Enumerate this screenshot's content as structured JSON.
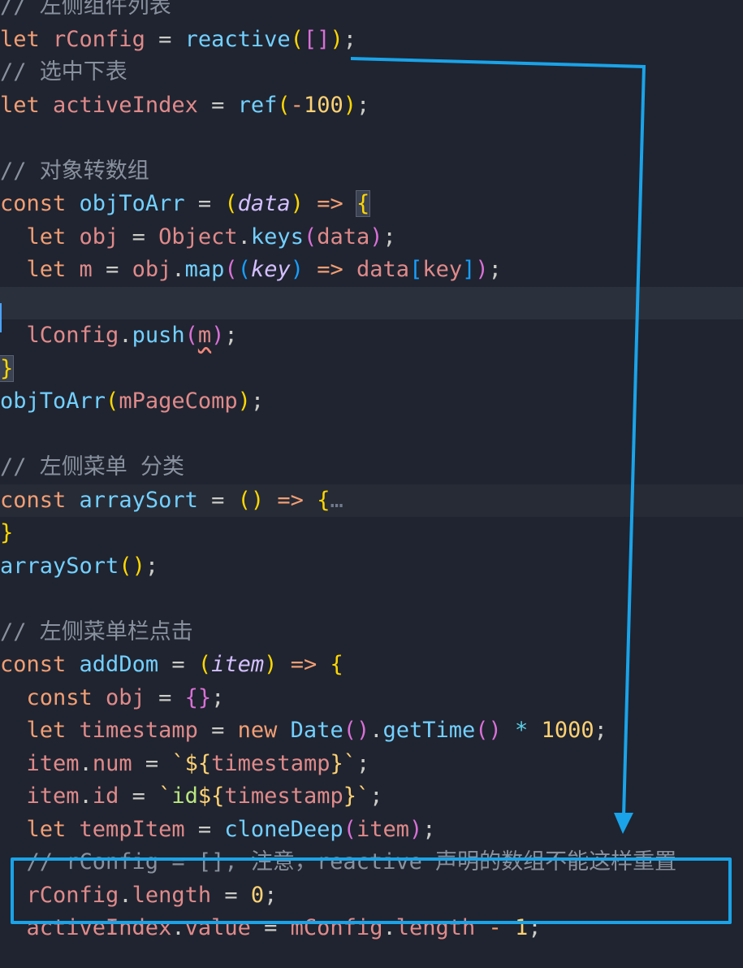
{
  "editor": {
    "lines": [
      {
        "id": "l0",
        "tokens": [
          {
            "t": "// 左侧组件列表",
            "c": "comment"
          }
        ]
      },
      {
        "id": "l1",
        "tokens": [
          {
            "t": "let ",
            "c": "kw"
          },
          {
            "t": "rConfig",
            "c": "var"
          },
          {
            "t": " = ",
            "c": "plain"
          },
          {
            "t": "reactive",
            "c": "fnb"
          },
          {
            "t": "(",
            "c": "p1"
          },
          {
            "t": "[]",
            "c": "p2"
          },
          {
            "t": ")",
            "c": "p1"
          },
          {
            "t": ";",
            "c": "plain"
          }
        ]
      },
      {
        "id": "l2",
        "tokens": [
          {
            "t": "// 选中下表",
            "c": "comment"
          }
        ]
      },
      {
        "id": "l3",
        "tokens": [
          {
            "t": "let ",
            "c": "kw"
          },
          {
            "t": "activeIndex",
            "c": "var"
          },
          {
            "t": " = ",
            "c": "plain"
          },
          {
            "t": "ref",
            "c": "fnb"
          },
          {
            "t": "(",
            "c": "p1"
          },
          {
            "t": "-",
            "c": "op"
          },
          {
            "t": "100",
            "c": "fn"
          },
          {
            "t": ")",
            "c": "p1"
          },
          {
            "t": ";",
            "c": "plain"
          }
        ]
      },
      {
        "id": "l4",
        "tokens": []
      },
      {
        "id": "l5",
        "tokens": [
          {
            "t": "// 对象转数组",
            "c": "comment"
          }
        ]
      },
      {
        "id": "l6",
        "tokens": [
          {
            "t": "const ",
            "c": "kw"
          },
          {
            "t": "objToArr",
            "c": "fnb"
          },
          {
            "t": " = ",
            "c": "plain"
          },
          {
            "t": "(",
            "c": "p1"
          },
          {
            "t": "data",
            "c": "param"
          },
          {
            "t": ")",
            "c": "p1"
          },
          {
            "t": " => ",
            "c": "op"
          },
          {
            "t": "{",
            "c": "p1",
            "brace": true
          }
        ]
      },
      {
        "id": "l7",
        "tokens": [
          {
            "t": "  let ",
            "c": "kw"
          },
          {
            "t": "obj",
            "c": "var"
          },
          {
            "t": " = ",
            "c": "plain"
          },
          {
            "t": "Object",
            "c": "var"
          },
          {
            "t": ".",
            "c": "plain"
          },
          {
            "t": "keys",
            "c": "fnb"
          },
          {
            "t": "(",
            "c": "p2"
          },
          {
            "t": "data",
            "c": "var"
          },
          {
            "t": ")",
            "c": "p2"
          },
          {
            "t": ";",
            "c": "plain"
          }
        ]
      },
      {
        "id": "l8",
        "tokens": [
          {
            "t": "  let ",
            "c": "kw"
          },
          {
            "t": "m",
            "c": "var"
          },
          {
            "t": " = ",
            "c": "plain"
          },
          {
            "t": "obj",
            "c": "var"
          },
          {
            "t": ".",
            "c": "plain"
          },
          {
            "t": "map",
            "c": "fnb"
          },
          {
            "t": "(",
            "c": "p2"
          },
          {
            "t": "(",
            "c": "p3"
          },
          {
            "t": "key",
            "c": "param"
          },
          {
            "t": ")",
            "c": "p3"
          },
          {
            "t": " => ",
            "c": "op"
          },
          {
            "t": "data",
            "c": "var"
          },
          {
            "t": "[",
            "c": "p3"
          },
          {
            "t": "key",
            "c": "var"
          },
          {
            "t": "]",
            "c": "p3"
          },
          {
            "t": ")",
            "c": "p2"
          },
          {
            "t": ";",
            "c": "plain"
          }
        ]
      },
      {
        "id": "l9",
        "tokens": [],
        "current": true
      },
      {
        "id": "l10",
        "tokens": [
          {
            "t": "  lConfig",
            "c": "var"
          },
          {
            "t": ".",
            "c": "plain"
          },
          {
            "t": "push",
            "c": "fnb"
          },
          {
            "t": "(",
            "c": "p2"
          },
          {
            "t": "m",
            "c": "var",
            "squiggle": true
          },
          {
            "t": ")",
            "c": "p2"
          },
          {
            "t": ";",
            "c": "plain"
          }
        ]
      },
      {
        "id": "l11",
        "tokens": [
          {
            "t": "}",
            "c": "p1",
            "brace": true
          }
        ]
      },
      {
        "id": "l12",
        "tokens": [
          {
            "t": "objToArr",
            "c": "fnb"
          },
          {
            "t": "(",
            "c": "p1"
          },
          {
            "t": "mPageComp",
            "c": "var"
          },
          {
            "t": ")",
            "c": "p1"
          },
          {
            "t": ";",
            "c": "plain"
          }
        ]
      },
      {
        "id": "l13",
        "tokens": []
      },
      {
        "id": "l14",
        "tokens": [
          {
            "t": "// 左侧菜单 分类",
            "c": "comment"
          }
        ]
      },
      {
        "id": "l15",
        "tokens": [
          {
            "t": "const ",
            "c": "kw"
          },
          {
            "t": "arraySort",
            "c": "fnb"
          },
          {
            "t": " = ",
            "c": "plain"
          },
          {
            "t": "()",
            "c": "p1"
          },
          {
            "t": " => ",
            "c": "op"
          },
          {
            "t": "{",
            "c": "p1"
          },
          {
            "t": "…",
            "c": "fold-dots"
          }
        ],
        "highlight": true
      },
      {
        "id": "l16",
        "tokens": [
          {
            "t": "}",
            "c": "p1"
          }
        ]
      },
      {
        "id": "l17",
        "tokens": [
          {
            "t": "arraySort",
            "c": "fnb"
          },
          {
            "t": "()",
            "c": "p1"
          },
          {
            "t": ";",
            "c": "plain"
          }
        ]
      },
      {
        "id": "l18",
        "tokens": []
      },
      {
        "id": "l19",
        "tokens": [
          {
            "t": "// 左侧菜单栏点击",
            "c": "comment"
          }
        ]
      },
      {
        "id": "l20",
        "tokens": [
          {
            "t": "const ",
            "c": "kw"
          },
          {
            "t": "addDom",
            "c": "fnb"
          },
          {
            "t": " = ",
            "c": "plain"
          },
          {
            "t": "(",
            "c": "p1"
          },
          {
            "t": "item",
            "c": "param"
          },
          {
            "t": ")",
            "c": "p1"
          },
          {
            "t": " => ",
            "c": "op"
          },
          {
            "t": "{",
            "c": "p1"
          }
        ]
      },
      {
        "id": "l21",
        "tokens": [
          {
            "t": "  const ",
            "c": "kw"
          },
          {
            "t": "obj",
            "c": "var"
          },
          {
            "t": " = ",
            "c": "plain"
          },
          {
            "t": "{}",
            "c": "p2"
          },
          {
            "t": ";",
            "c": "plain"
          }
        ]
      },
      {
        "id": "l22",
        "tokens": [
          {
            "t": "  let ",
            "c": "kw"
          },
          {
            "t": "timestamp",
            "c": "var"
          },
          {
            "t": " = ",
            "c": "plain"
          },
          {
            "t": "new ",
            "c": "kw"
          },
          {
            "t": "Date",
            "c": "cls"
          },
          {
            "t": "()",
            "c": "p2"
          },
          {
            "t": ".",
            "c": "plain"
          },
          {
            "t": "getTime",
            "c": "fnb"
          },
          {
            "t": "()",
            "c": "p2"
          },
          {
            "t": " * ",
            "c": "prop"
          },
          {
            "t": "1000",
            "c": "fn"
          },
          {
            "t": ";",
            "c": "plain"
          }
        ]
      },
      {
        "id": "l23",
        "tokens": [
          {
            "t": "  item",
            "c": "var"
          },
          {
            "t": ".",
            "c": "plain"
          },
          {
            "t": "num",
            "c": "var"
          },
          {
            "t": " = ",
            "c": "plain"
          },
          {
            "t": "`${",
            "c": "fn"
          },
          {
            "t": "timestamp",
            "c": "var"
          },
          {
            "t": "}`",
            "c": "fn"
          },
          {
            "t": ";",
            "c": "plain"
          }
        ]
      },
      {
        "id": "l24",
        "tokens": [
          {
            "t": "  item",
            "c": "var"
          },
          {
            "t": ".",
            "c": "plain"
          },
          {
            "t": "id",
            "c": "var"
          },
          {
            "t": " = ",
            "c": "plain"
          },
          {
            "t": "`",
            "c": "fn"
          },
          {
            "t": "id",
            "c": "str"
          },
          {
            "t": "${",
            "c": "fn"
          },
          {
            "t": "timestamp",
            "c": "var"
          },
          {
            "t": "}`",
            "c": "fn"
          },
          {
            "t": ";",
            "c": "plain"
          }
        ]
      },
      {
        "id": "l25",
        "tokens": [
          {
            "t": "  let ",
            "c": "kw"
          },
          {
            "t": "tempItem",
            "c": "var"
          },
          {
            "t": " = ",
            "c": "plain"
          },
          {
            "t": "cloneDeep",
            "c": "fnb"
          },
          {
            "t": "(",
            "c": "p2"
          },
          {
            "t": "item",
            "c": "var"
          },
          {
            "t": ")",
            "c": "p2"
          },
          {
            "t": ";",
            "c": "plain"
          }
        ]
      },
      {
        "id": "l26",
        "tokens": [
          {
            "t": "  // rConfig = []; 注意，reactive 声明的数组不能这样重置",
            "c": "comment"
          }
        ]
      },
      {
        "id": "l27",
        "tokens": [
          {
            "t": "  rConfig",
            "c": "var"
          },
          {
            "t": ".",
            "c": "plain"
          },
          {
            "t": "length",
            "c": "var"
          },
          {
            "t": " = ",
            "c": "plain"
          },
          {
            "t": "0",
            "c": "fn"
          },
          {
            "t": ";",
            "c": "plain"
          }
        ]
      },
      {
        "id": "l28",
        "tokens": [
          {
            "t": "  activeIndex",
            "c": "var"
          },
          {
            "t": ".",
            "c": "plain"
          },
          {
            "t": "value",
            "c": "var"
          },
          {
            "t": " = ",
            "c": "plain"
          },
          {
            "t": "mConfig",
            "c": "var"
          },
          {
            "t": ".",
            "c": "plain"
          },
          {
            "t": "length",
            "c": "var"
          },
          {
            "t": " - ",
            "c": "op"
          },
          {
            "t": "1",
            "c": "fn"
          },
          {
            "t": ";",
            "c": "plain"
          }
        ]
      }
    ]
  },
  "annotation": {
    "color": "#1aa3e8"
  },
  "colors": {
    "background": "#1f2430",
    "comment": "#8a919e"
  }
}
